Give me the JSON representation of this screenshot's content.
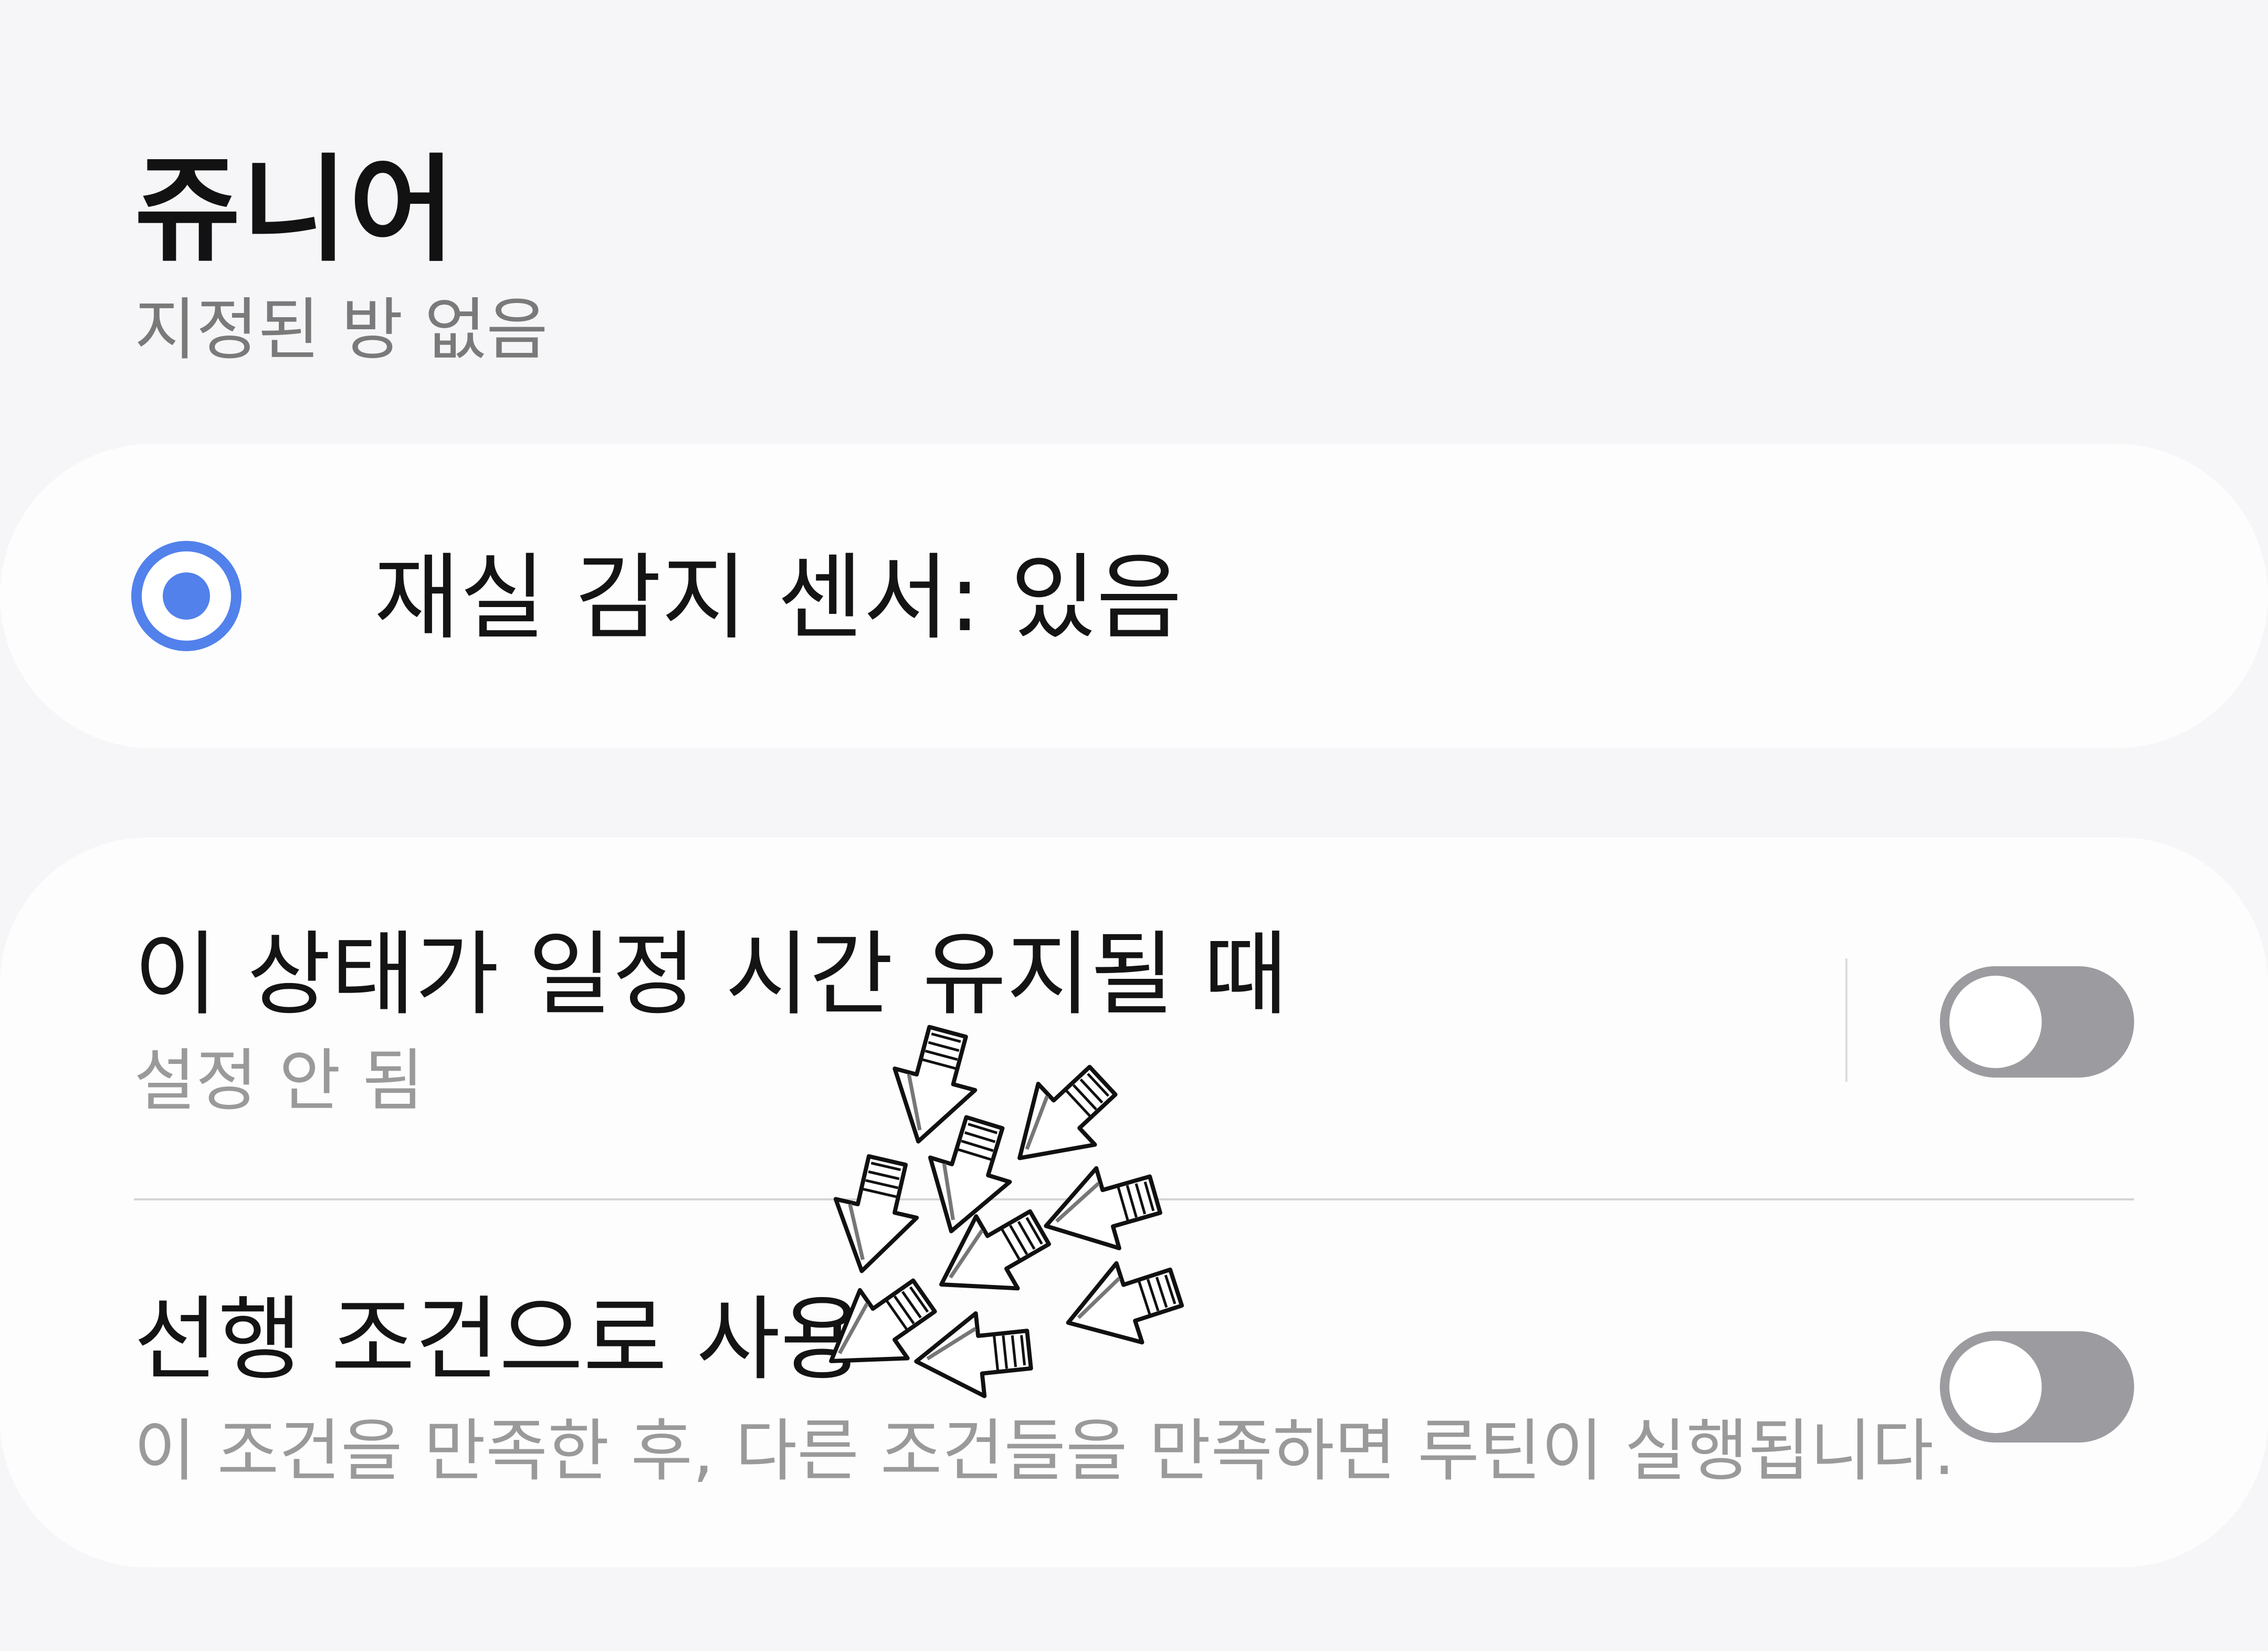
{
  "header": {
    "title": "쥬니어",
    "subtitle": "지정된 방 없음"
  },
  "state_option": {
    "label": "재실 감지 센서: 있음",
    "selected": true
  },
  "options": [
    {
      "title": "이 상태가 일정 시간 유지될 때",
      "subtitle": "설정 안 됨",
      "enabled": false
    },
    {
      "title": "선행 조건으로 사용",
      "subtitle": "이 조건을 만족한 후, 다른 조건들을 만족하면 루틴이 실행됩니다.",
      "enabled": false
    }
  ],
  "colors": {
    "accent": "#5281ec",
    "toggle_off": "#9c9ca0",
    "background": "#f6f6f8",
    "card": "#fdfdfe"
  },
  "icons": {
    "radio": "radio-selected-icon",
    "overlay": "sketch-arrow-icon"
  }
}
